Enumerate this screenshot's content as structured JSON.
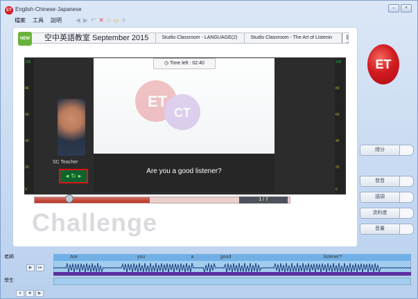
{
  "app": {
    "title": "English·Chinese·Japanese"
  },
  "menu": {
    "items": [
      "檔案",
      "工具",
      "說明"
    ]
  },
  "breadcrumb": {
    "series": "空中英語教室 September 2015",
    "course": "Studio Classroom - LANGUAGE(2)",
    "lesson": "Studio Classroom - The Art of Listenin",
    "transcript_button": "回課文",
    "new_badge": "NEW"
  },
  "player": {
    "time_left_label": "Time left :",
    "time_left": "02:40",
    "teacher_name": "SC Teacher",
    "caption": "Are you a good listener?",
    "page_counter": "1 / 7",
    "progress_fraction": 0.45
  },
  "meter": {
    "ticks": [
      "100",
      "80",
      "60",
      "40",
      "20",
      "0"
    ]
  },
  "challenge_label": "Challenge",
  "scores": [
    {
      "label": "總分"
    },
    {
      "label": "發音"
    },
    {
      "label": "語調"
    },
    {
      "label": "流利度"
    },
    {
      "label": "音量"
    }
  ],
  "recorder": {
    "teacher_label": "老師",
    "student_label": "學生",
    "words": [
      "Are",
      "you",
      "a",
      "good",
      "listener?"
    ]
  },
  "colors": {
    "accent": "#d41b22",
    "wave": "#1b3c7a",
    "divider": "#5e2ea2",
    "highlight": "#e01414"
  }
}
